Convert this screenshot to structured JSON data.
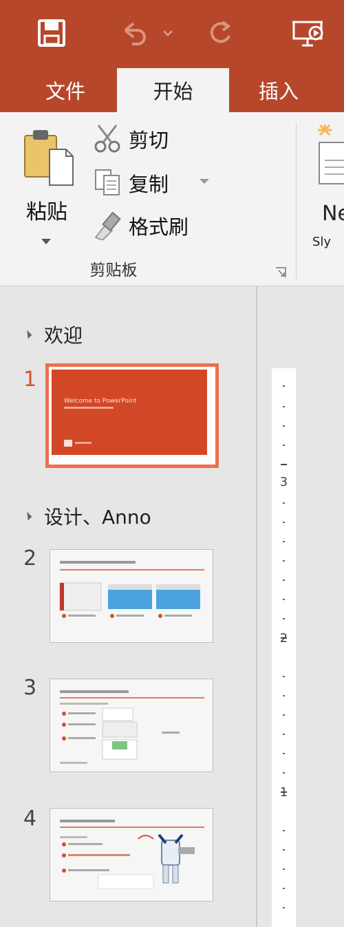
{
  "quick_access": {
    "save_icon": "save-icon",
    "undo_icon": "undo-icon",
    "redo_icon": "redo-icon",
    "present_icon": "present-from-beginning-icon",
    "bar_color": "#b7472a"
  },
  "tabs": [
    {
      "label": "文件",
      "active": false
    },
    {
      "label": "开始",
      "active": true
    },
    {
      "label": "插入",
      "active": false
    }
  ],
  "ribbon": {
    "paste_label": "粘贴",
    "cut_label": "剪切",
    "copy_label": "复制",
    "format_painter_label": "格式刷",
    "group_label": "剪贴板",
    "new_slide_label": "Ne",
    "new_slide_sub": "Sly"
  },
  "slide_panel": {
    "sections": [
      {
        "name": "欢迎"
      },
      {
        "name": "设计、Anno"
      }
    ],
    "slides": [
      {
        "number": "1",
        "selected": true,
        "title": "Welcome to PowerPoint"
      },
      {
        "number": "2",
        "selected": false
      },
      {
        "number": "3",
        "selected": false
      },
      {
        "number": "4",
        "selected": false
      }
    ]
  },
  "ruler": {
    "labels": [
      "3",
      "2",
      "1"
    ]
  },
  "colors": {
    "accent": "#b7472a",
    "selection": "#ee6f4e",
    "slide_title_bg": "#d24726"
  }
}
